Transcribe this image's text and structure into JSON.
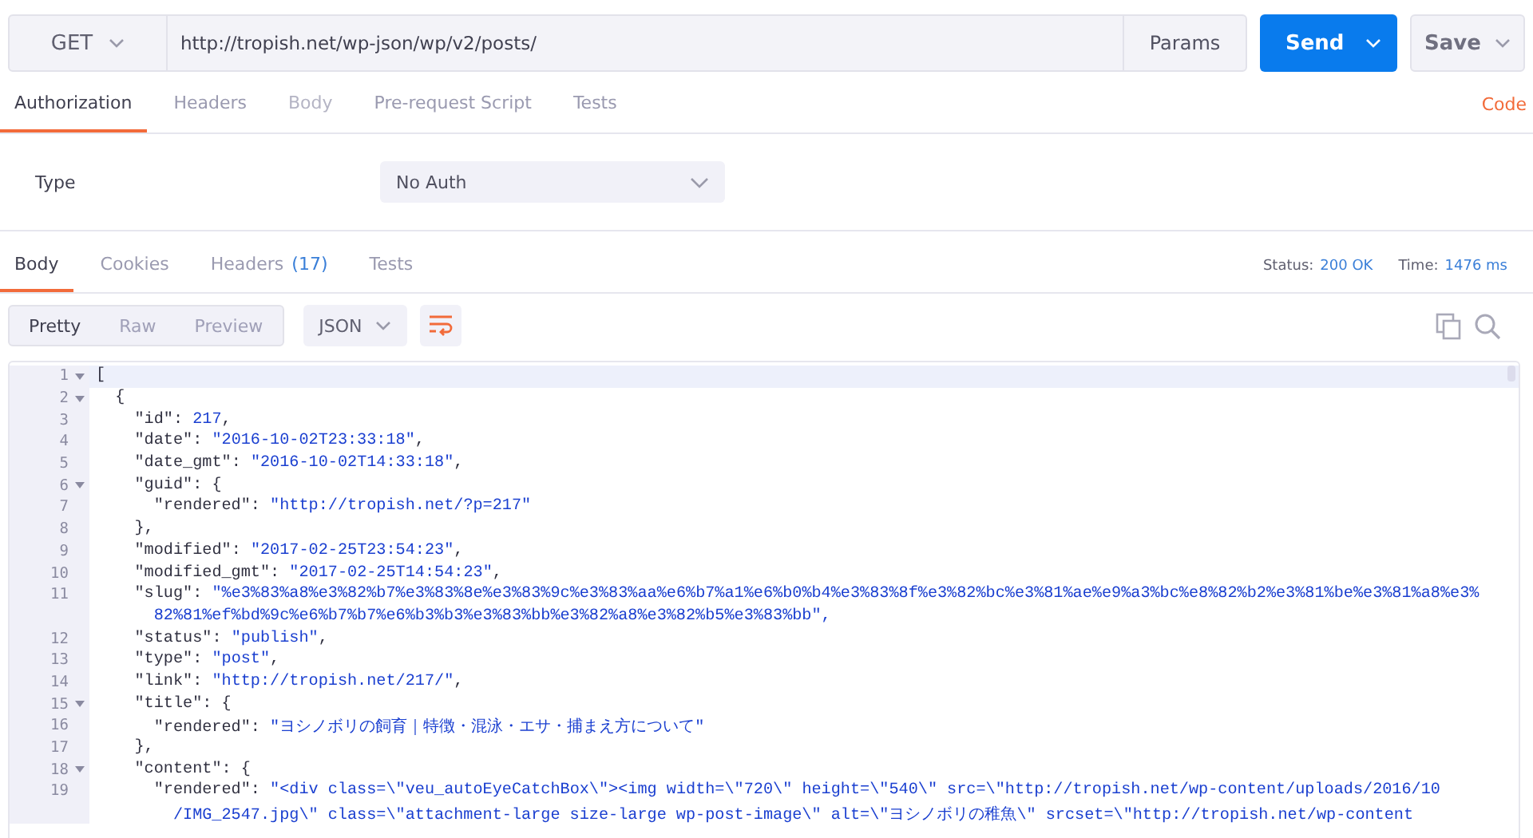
{
  "request": {
    "method": "GET",
    "url": "http://tropish.net/wp-json/wp/v2/posts/",
    "params": "Params",
    "send": "Send",
    "save": "Save"
  },
  "request_tabs": [
    {
      "label": "Authorization",
      "selected": true,
      "disabled": false
    },
    {
      "label": "Headers",
      "selected": false,
      "disabled": false
    },
    {
      "label": "Body",
      "selected": false,
      "disabled": true
    },
    {
      "label": "Pre-request Script",
      "selected": false,
      "disabled": false
    },
    {
      "label": "Tests",
      "selected": false,
      "disabled": false
    }
  ],
  "code_link": "Code",
  "auth": {
    "type_label": "Type",
    "type_value": "No Auth"
  },
  "response_tabs": [
    {
      "label": "Body",
      "selected": true
    },
    {
      "label": "Cookies",
      "selected": false
    },
    {
      "label": "Headers",
      "count": "(17)",
      "selected": false
    },
    {
      "label": "Tests",
      "selected": false
    }
  ],
  "status": {
    "label": "Status:",
    "value": "200 OK"
  },
  "time": {
    "label": "Time:",
    "value": "1476 ms"
  },
  "view_modes": [
    {
      "label": "Pretty",
      "selected": true
    },
    {
      "label": "Raw",
      "selected": false
    },
    {
      "label": "Preview",
      "selected": false
    }
  ],
  "format": "JSON",
  "wrap_on": true,
  "code_lines": [
    {
      "num": "1",
      "foldable": true,
      "current": true,
      "text": "["
    },
    {
      "num": "2",
      "foldable": true,
      "current": false,
      "text": "  {"
    },
    {
      "num": "3",
      "foldable": false,
      "current": false,
      "text": "    \"id\": 217,"
    },
    {
      "num": "4",
      "foldable": false,
      "current": false,
      "text": "    \"date\": \"2016-10-02T23:33:18\","
    },
    {
      "num": "5",
      "foldable": false,
      "current": false,
      "text": "    \"date_gmt\": \"2016-10-02T14:33:18\","
    },
    {
      "num": "6",
      "foldable": true,
      "current": false,
      "text": "    \"guid\": {"
    },
    {
      "num": "7",
      "foldable": false,
      "current": false,
      "text": "      \"rendered\": \"http://tropish.net/?p=217\""
    },
    {
      "num": "8",
      "foldable": false,
      "current": false,
      "text": "    },"
    },
    {
      "num": "9",
      "foldable": false,
      "current": false,
      "text": "    \"modified\": \"2017-02-25T23:54:23\","
    },
    {
      "num": "10",
      "foldable": false,
      "current": false,
      "text": "    \"modified_gmt\": \"2017-02-25T14:54:23\","
    },
    {
      "num": "11",
      "foldable": false,
      "current": false,
      "text": "    \"slug\": \"%e3%83%a8%e3%82%b7%e3%83%8e%e3%83%9c%e3%83%aa%e6%b7%a1%e6%b0%b4%e3%83%8f%e3%82%bc%e3%81%ae%e9%a3%bc%e8%82%b2%e3%81%be%e3%81%a8%e3%",
      "wrapped": [
        "      82%81%ef%bd%9c%e6%b7%b7%e6%b3%b3%e3%83%bb%e3%82%a8%e3%82%b5%e3%83%bb\","
      ]
    },
    {
      "num": "12",
      "foldable": false,
      "current": false,
      "text": "    \"status\": \"publish\","
    },
    {
      "num": "13",
      "foldable": false,
      "current": false,
      "text": "    \"type\": \"post\","
    },
    {
      "num": "14",
      "foldable": false,
      "current": false,
      "text": "    \"link\": \"http://tropish.net/217/\","
    },
    {
      "num": "15",
      "foldable": true,
      "current": false,
      "text": "    \"title\": {"
    },
    {
      "num": "16",
      "foldable": false,
      "current": false,
      "text": "      \"rendered\": \"ヨシノボリの飼育｜特徴・混泳・エサ・捕まえ方について\""
    },
    {
      "num": "17",
      "foldable": false,
      "current": false,
      "text": "    },"
    },
    {
      "num": "18",
      "foldable": true,
      "current": false,
      "text": "    \"content\": {"
    },
    {
      "num": "19",
      "foldable": false,
      "current": false,
      "text": "      \"rendered\": \"<div class=\\\"veu_autoEyeCatchBox\\\"><img width=\\\"720\\\" height=\\\"540\\\" src=\\\"http://tropish.net/wp-content/uploads/2016/10",
      "wrapped": [
        "        /IMG_2547.jpg\\\" class=\\\"attachment-large size-large wp-post-image\\\" alt=\\\"ヨシノボリの稚魚\\\" srcset=\\\"http://tropish.net/wp-content"
      ]
    }
  ]
}
